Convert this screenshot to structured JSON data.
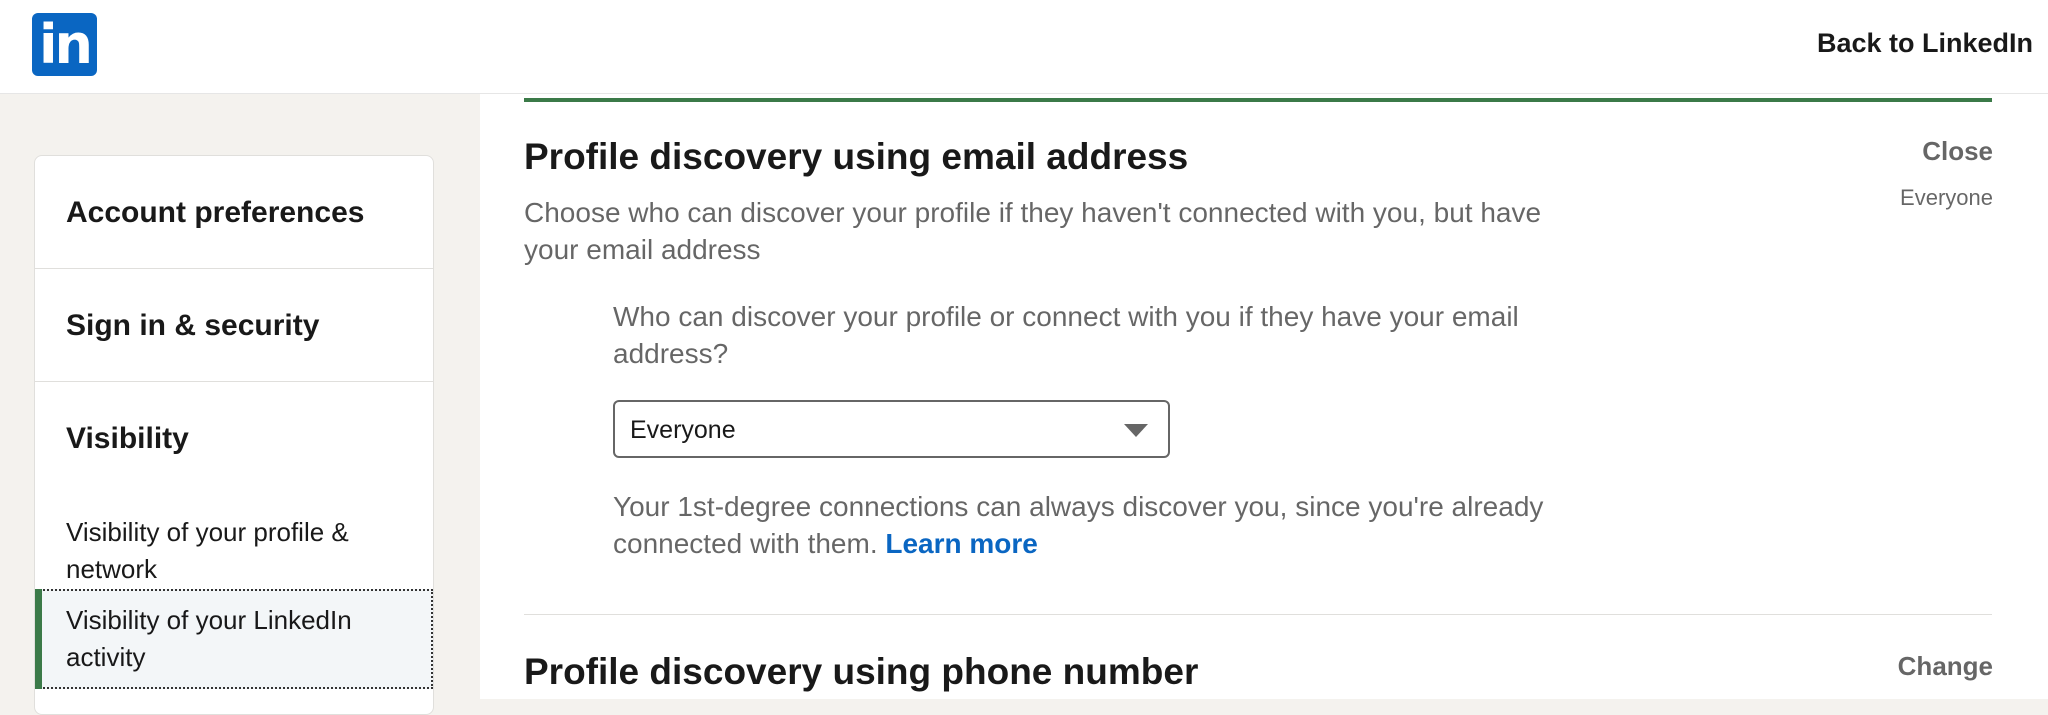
{
  "header": {
    "logo_text": "in",
    "back_link": "Back to LinkedIn",
    "brand_color": "#0a66c2"
  },
  "sidebar": {
    "sections": [
      {
        "label": "Account preferences"
      },
      {
        "label": "Sign in & security"
      },
      {
        "label": "Visibility"
      }
    ],
    "subitems": [
      {
        "label": "Visibility of your profile & network",
        "active": false
      },
      {
        "label": "Visibility of your LinkedIn activity",
        "active": true
      }
    ],
    "active_color": "#3b7a48"
  },
  "main": {
    "email_section": {
      "title": "Profile discovery using email address",
      "description": "Choose who can discover your profile if they haven't connected with you, but have your email address",
      "close_label": "Close",
      "current_value": "Everyone",
      "question": "Who can discover your profile or connect with you if they have your email address?",
      "select_value": "Everyone",
      "note": "Your 1st-degree connections can always discover you, since you're already connected with them.",
      "learn_more": "Learn more"
    },
    "phone_section": {
      "title": "Profile discovery using phone number",
      "change_label": "Change"
    }
  }
}
